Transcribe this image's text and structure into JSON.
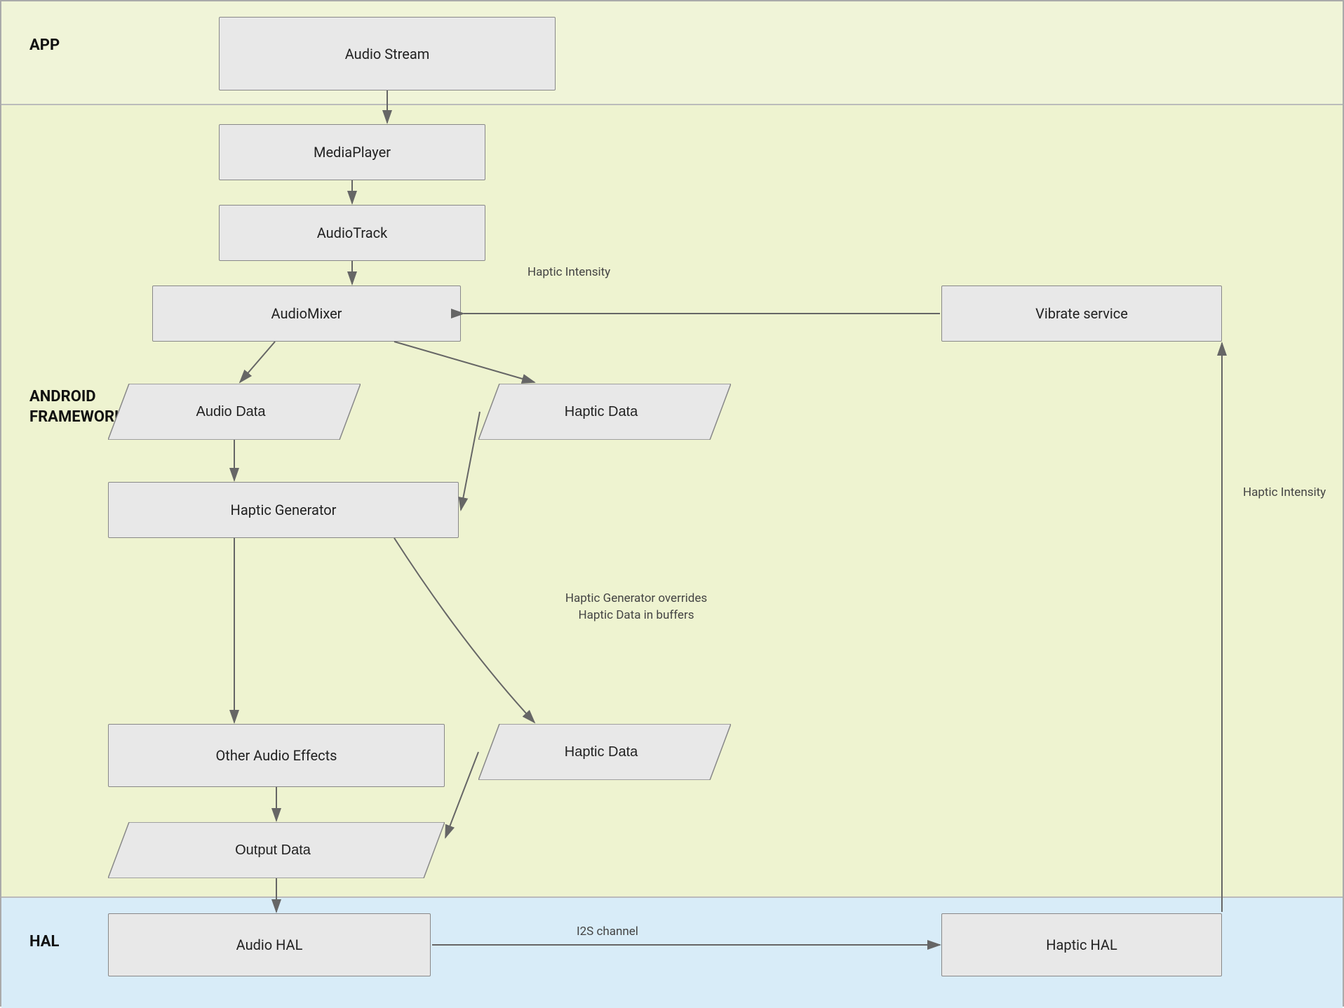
{
  "layers": {
    "app": {
      "label": "APP"
    },
    "framework": {
      "label": "ANDROID\nFRAMEWORK"
    },
    "hal": {
      "label": "HAL"
    }
  },
  "boxes": {
    "audio_stream": "Audio Stream",
    "media_player": "MediaPlayer",
    "audio_track": "AudioTrack",
    "audio_mixer": "AudioMixer",
    "vibrate_service": "Vibrate service",
    "audio_data": "Audio Data",
    "haptic_data_1": "Haptic Data",
    "haptic_generator": "Haptic Generator",
    "other_audio_effects": "Other Audio Effects",
    "haptic_data_2": "Haptic Data",
    "output_data": "Output Data",
    "audio_hal": "Audio HAL",
    "haptic_hal": "Haptic HAL"
  },
  "labels": {
    "haptic_intensity_1": "Haptic Intensity",
    "haptic_intensity_2": "Haptic Intensity",
    "haptic_generator_overrides": "Haptic Generator overrides\nHaptic Data in buffers",
    "i2s_channel": "I2S channel"
  },
  "colors": {
    "app_bg": "#f0f4d8",
    "framework_bg": "#eef3d0",
    "hal_bg": "#d8ecf8",
    "box_fill": "#e8e8e8",
    "box_stroke": "#888888",
    "arrow": "#666666"
  }
}
